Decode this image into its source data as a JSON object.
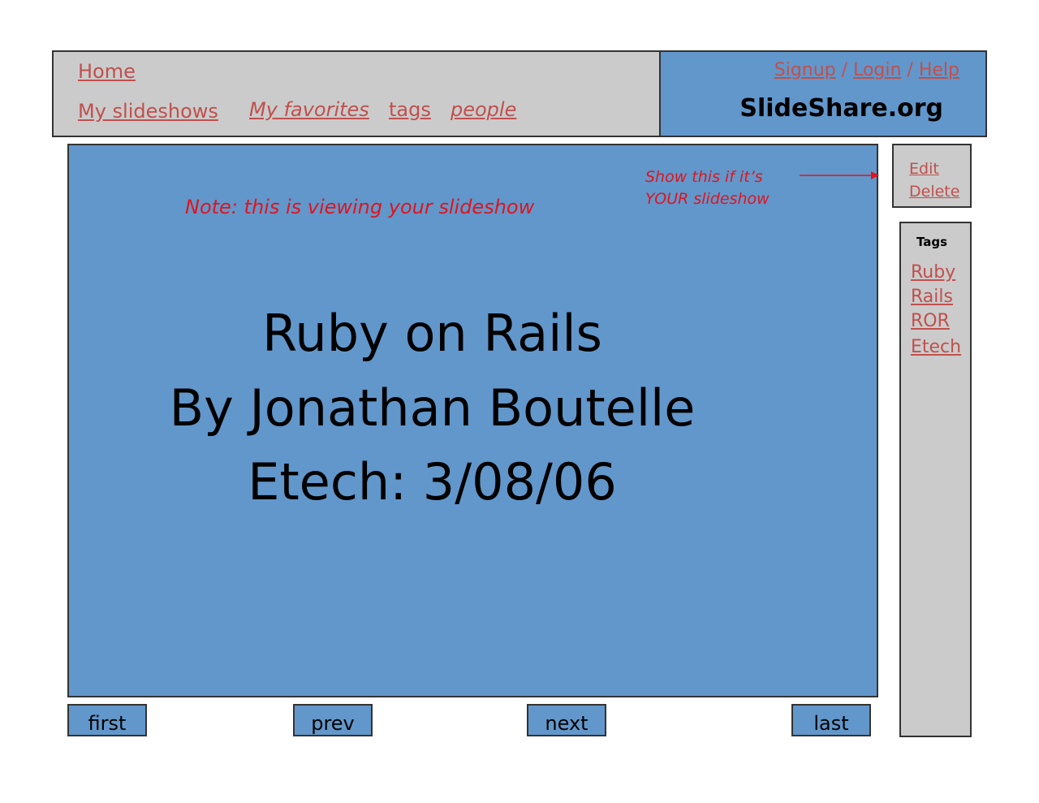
{
  "header": {
    "nav": {
      "home": "Home",
      "my_slideshows": "My slideshows",
      "my_favorites": "My favorites",
      "tags": "tags",
      "people": "people"
    },
    "auth": {
      "signup": "Signup",
      "login": "Login",
      "help": "Help",
      "separator": " / "
    },
    "site_title": "SlideShare.org"
  },
  "slide": {
    "note": "Note: this is viewing your slideshow",
    "owner_note_line1": "Show this if it’s",
    "owner_note_line2": "YOUR slideshow",
    "title_line1": "Ruby on Rails",
    "title_line2": "By Jonathan Boutelle",
    "title_line3": "Etech: 3/08/06"
  },
  "owner_actions": {
    "edit": "Edit",
    "delete": "Delete"
  },
  "tags_panel": {
    "heading": "Tags",
    "items": [
      "Ruby",
      "Rails",
      "ROR",
      "Etech"
    ]
  },
  "navigation": {
    "first": "first",
    "prev": "prev",
    "next": "next",
    "last": "last"
  },
  "colors": {
    "link": "#c0504d",
    "annotation": "#e0141e",
    "panel_blue": "#6297cb",
    "panel_gray": "#cbcbcb"
  }
}
